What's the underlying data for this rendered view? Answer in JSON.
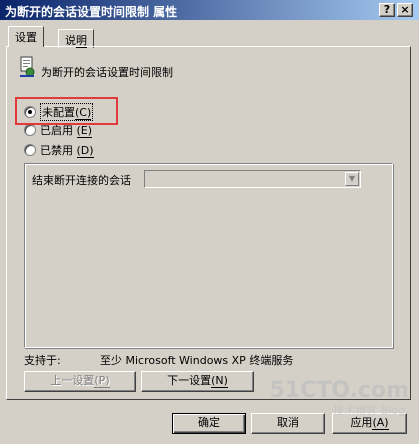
{
  "window": {
    "title": "为断开的会话设置时间限制 属性",
    "help_button": "?",
    "close_button": "×"
  },
  "tabs": [
    {
      "label": "设置",
      "mnemonic": "",
      "active": true
    },
    {
      "label": "说",
      "mnemonic": "明",
      "active": false
    }
  ],
  "policy": {
    "icon": "policy-setting-icon",
    "title": "为断开的会话设置时间限制"
  },
  "options": [
    {
      "label": "未配置",
      "mnemonic": "(C)",
      "checked": true
    },
    {
      "label": "已启用",
      "mnemonic": "(E)",
      "checked": false
    },
    {
      "label": "已禁用",
      "mnemonic": "(D)",
      "checked": false
    }
  ],
  "option_panel": {
    "label": "结束断开连接的会话",
    "combo_value": ""
  },
  "supported": {
    "label": "支持于:",
    "value": "至少 Microsoft Windows XP 终端服务"
  },
  "nav": {
    "prev_label": "上一设置",
    "prev_mnemonic": "(P)",
    "next_label": "下一设置",
    "next_mnemonic": "(N)"
  },
  "footer": {
    "ok_label": "确定",
    "cancel_label": "取消",
    "apply_label": "应用",
    "apply_mnemonic": "(A)"
  },
  "watermark": {
    "main": "51CTO.com",
    "sub": "技术博客  Blog"
  },
  "colors": {
    "highlight": "#e23a3a",
    "dialog_bg": "#d4d0c8"
  }
}
